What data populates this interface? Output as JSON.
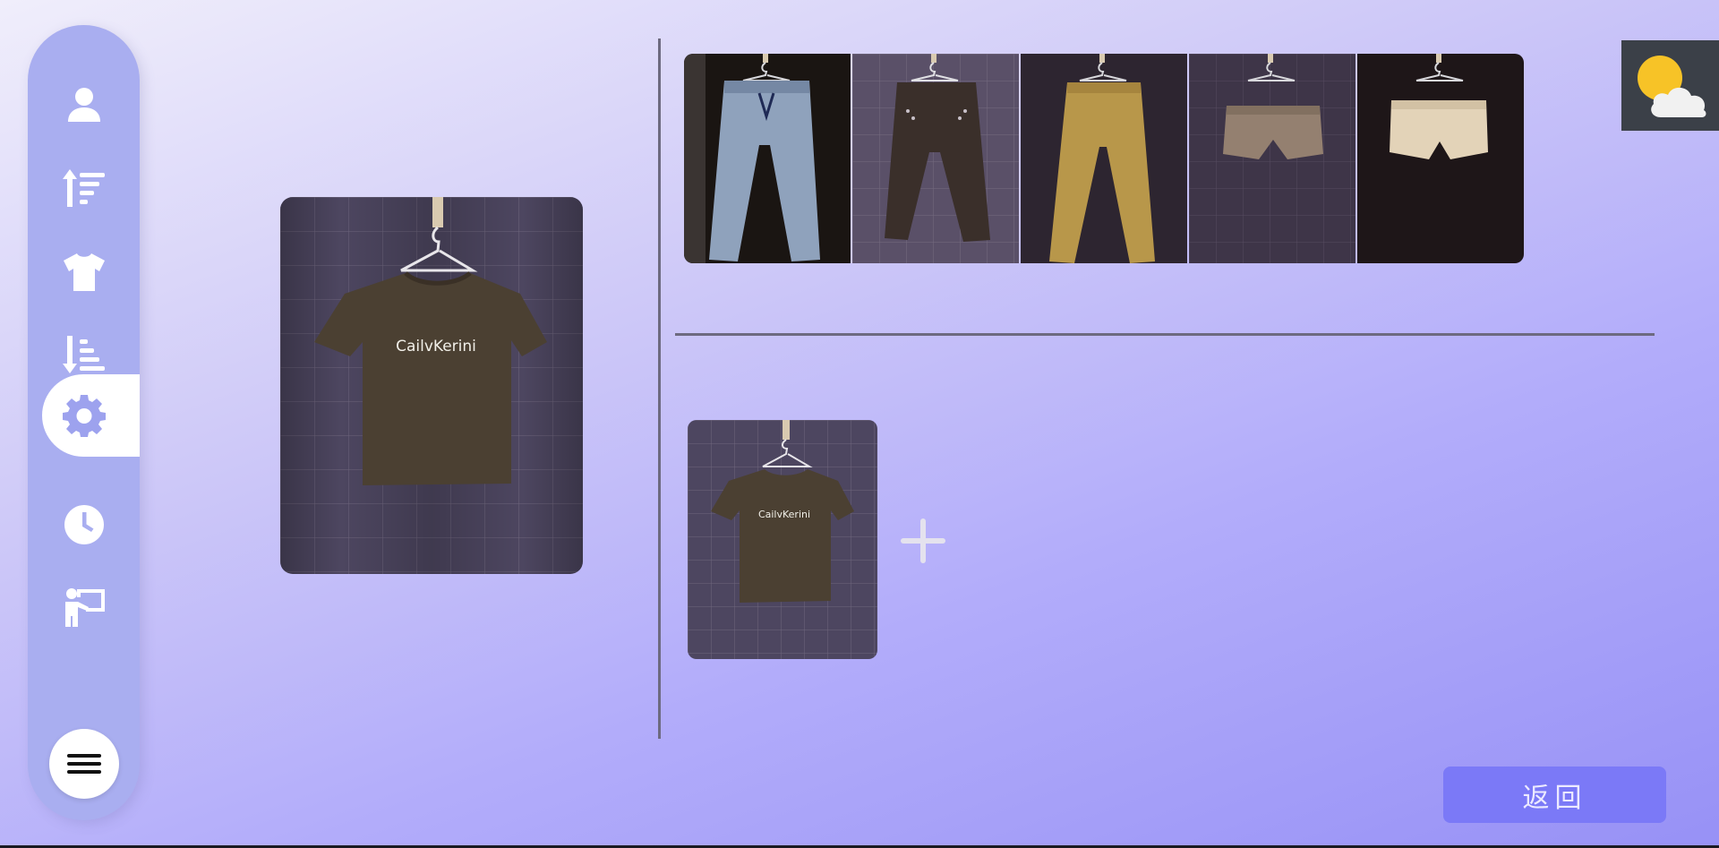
{
  "sidebar": {
    "items": [
      {
        "icon": "user-icon",
        "active": false
      },
      {
        "icon": "sort-ascending-icon",
        "active": false
      },
      {
        "icon": "tshirt-icon",
        "active": false
      },
      {
        "icon": "sort-descending-icon",
        "active": false
      },
      {
        "icon": "gear-icon",
        "active": true
      },
      {
        "icon": "clock-icon",
        "active": false
      },
      {
        "icon": "presenter-icon",
        "active": false
      }
    ],
    "menu_icon": "menu-icon"
  },
  "selected_item": {
    "image": "brown-tshirt",
    "print_text": "CailvKerini"
  },
  "bottoms_gallery": [
    {
      "image": "light-blue-jeans"
    },
    {
      "image": "dark-brown-trousers"
    },
    {
      "image": "khaki-trousers"
    },
    {
      "image": "tan-shorts"
    },
    {
      "image": "cream-shorts"
    }
  ],
  "outfit": {
    "items": [
      {
        "image": "brown-tshirt",
        "print_text": "CailvKerini"
      }
    ],
    "add_icon": "plus-icon"
  },
  "weather": {
    "icon": "partly-cloudy-icon"
  },
  "back_button": {
    "label": "返回"
  },
  "colors": {
    "sidebar": "#a9aef0",
    "accent_button": "#7b79f7",
    "backdrop_purple": "#4a4560",
    "tshirt_brown": "#4b4032"
  }
}
